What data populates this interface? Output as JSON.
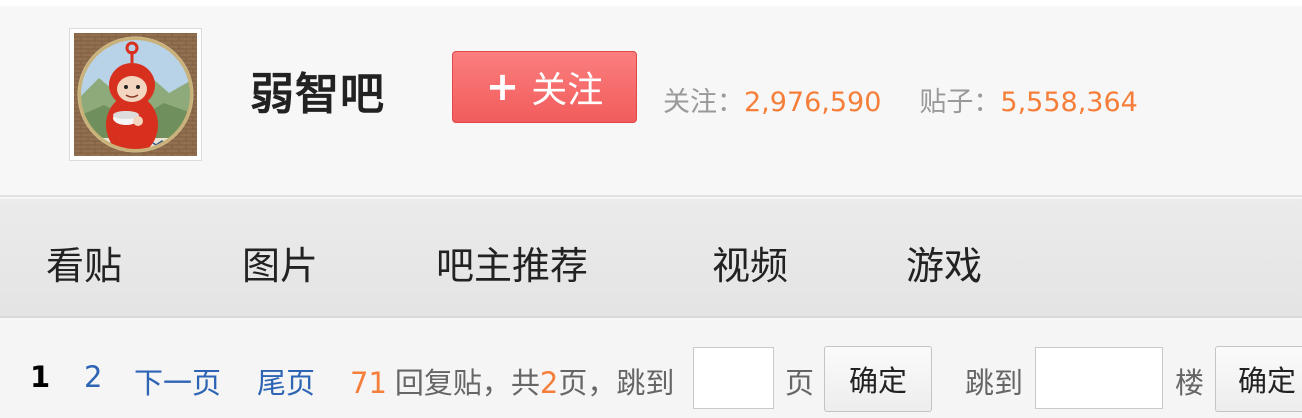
{
  "forum": {
    "name": "弱智吧",
    "follow_label": "关注",
    "follow_plus": "+",
    "followers_label": "关注：",
    "followers_value": "2,976,590",
    "posts_label": "贴子：",
    "posts_value": "5,558,364"
  },
  "nav": {
    "items": [
      {
        "label": "看贴"
      },
      {
        "label": "图片"
      },
      {
        "label": "吧主推荐"
      },
      {
        "label": "视频"
      },
      {
        "label": "游戏"
      }
    ]
  },
  "pager": {
    "current_page": "1",
    "page_2": "2",
    "next_page": "下一页",
    "last_page": "尾页",
    "reply_count": "71",
    "reply_label": "回复贴，共",
    "total_pages": "2",
    "pages_suffix": "页，",
    "jump_to_label": "跳到",
    "page_unit": "页",
    "confirm_label": "确定",
    "jump_to_floor_label": "跳到",
    "floor_unit": "楼",
    "confirm_floor_label": "确定"
  },
  "icons": {
    "avatar": "forum-avatar-image"
  },
  "colors": {
    "follow_button": "#f25c5c",
    "stat_numbers": "#f57f3a",
    "link_blue": "#2d64b3"
  }
}
